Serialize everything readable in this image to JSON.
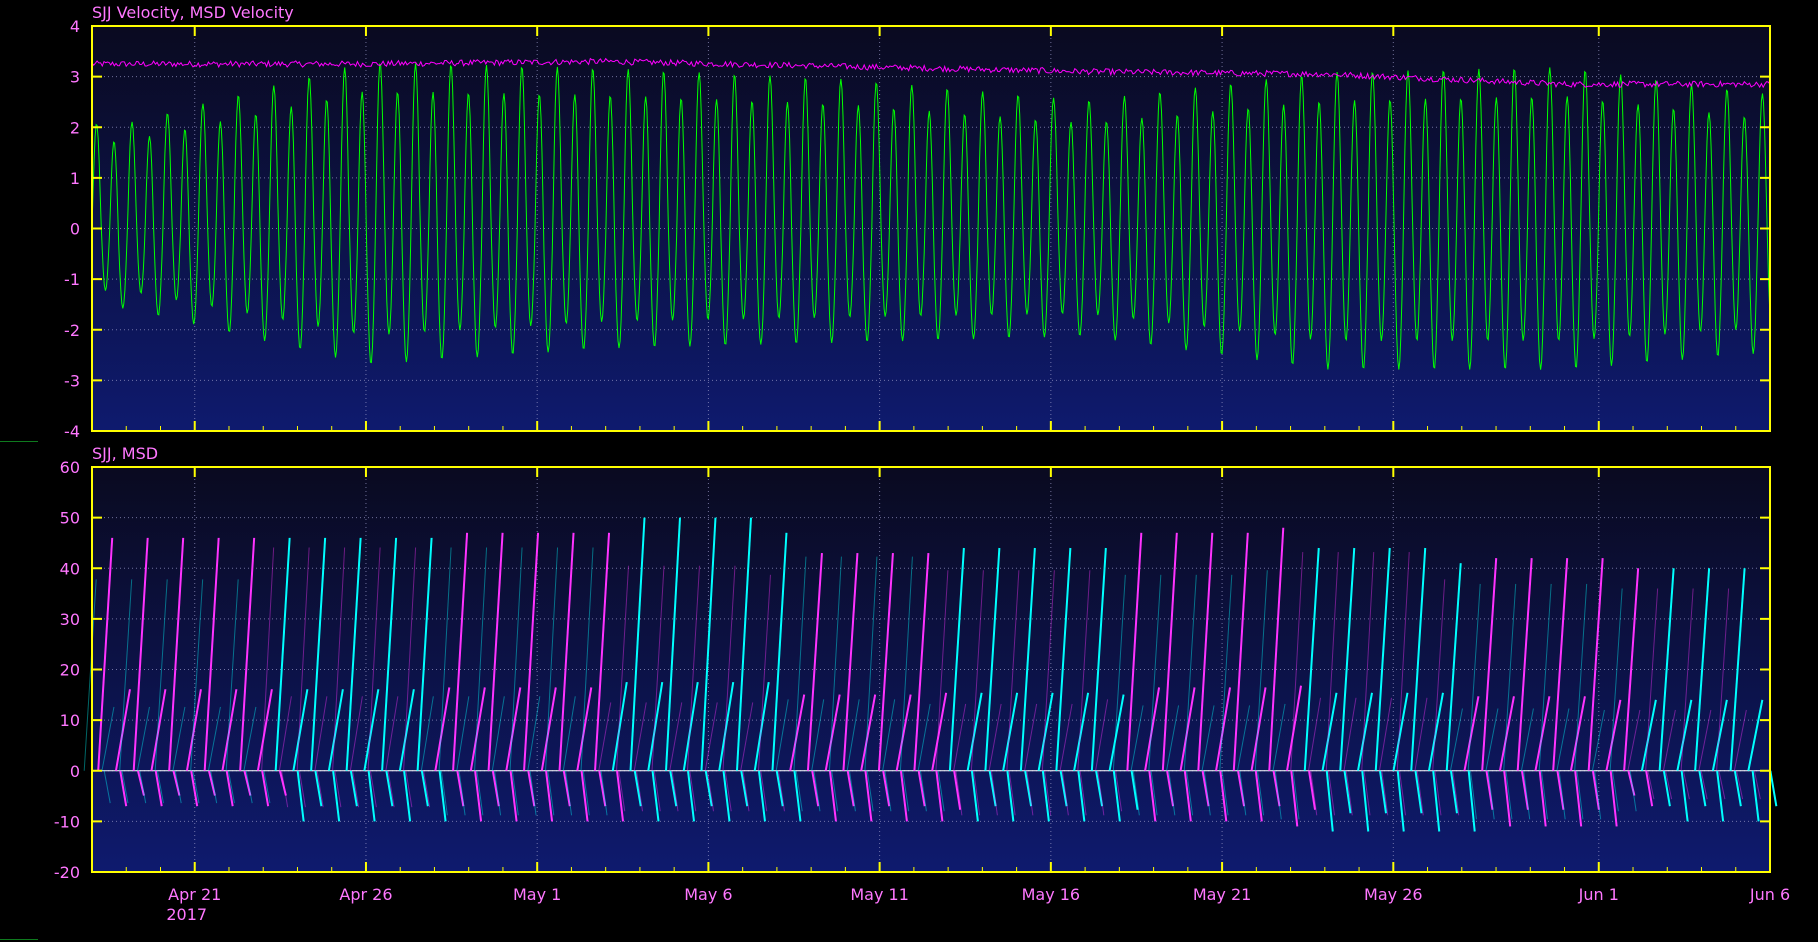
{
  "colors": {
    "background": "#000000",
    "frame": "#ffff00",
    "grid": "#9a9ac8",
    "label": "#ff77ff",
    "panel_top": "#0a0a20",
    "panel_bottom": "#0e1a6e",
    "sjj_velocity": "#00ff00",
    "msd_velocity": "#ff00ff",
    "sjj": "#ff33ff",
    "msd": "#00ffff",
    "side_mark": "#0e7a1e"
  },
  "chart_data": [
    {
      "type": "line",
      "title": "SJJ Velocity, MSD Velocity",
      "xlabel": "",
      "ylabel": "",
      "ylim": [
        -4,
        4
      ],
      "yticks": [
        "4",
        "3",
        "2",
        "1",
        "0",
        "-1",
        "-2",
        "-3",
        "-4"
      ],
      "grid": true,
      "series": [
        {
          "name": "MSD Velocity",
          "color": "#ff00ff",
          "description_of_shape": "noisy near-constant signal",
          "x_dates": [
            "2017-04-19",
            "2017-04-26",
            "2017-05-03",
            "2017-05-10",
            "2017-05-17",
            "2017-05-24",
            "2017-05-31",
            "2017-06-06"
          ],
          "values": [
            3.25,
            3.25,
            3.3,
            3.2,
            3.1,
            3.05,
            2.85,
            2.85
          ]
        },
        {
          "name": "SJJ Velocity",
          "color": "#00ff00",
          "description_of_shape": "tidal oscillation, two cycles per day",
          "x_dates": [
            "2017-04-19",
            "2017-04-26",
            "2017-05-03",
            "2017-05-10",
            "2017-05-17",
            "2017-05-24",
            "2017-05-31",
            "2017-06-06"
          ],
          "high_values": [
            1.9,
            3.0,
            2.9,
            2.7,
            2.3,
            2.8,
            2.9,
            2.4
          ],
          "low_values": [
            -1.4,
            -2.4,
            -2.1,
            -2.0,
            -1.9,
            -2.5,
            -2.5,
            -2.2
          ]
        }
      ]
    },
    {
      "type": "line",
      "title": "SJJ, MSD",
      "xlabel": "",
      "ylabel": "",
      "ylim": [
        -20,
        60
      ],
      "yticks": [
        "60",
        "50",
        "40",
        "30",
        "20",
        "10",
        "0",
        "-10",
        "-20"
      ],
      "grid": true,
      "series": [
        {
          "name": "SJJ",
          "color": "#ff33ff",
          "description_of_shape": "repeating sawtooth ramps",
          "peak_values": [
            46,
            49,
            47,
            45,
            43,
            44,
            47,
            48,
            42,
            40
          ],
          "trough_values": [
            -7,
            -9,
            -10,
            -10,
            -10,
            -11,
            -10,
            -11,
            -11,
            -7
          ]
        },
        {
          "name": "MSD",
          "color": "#00ffff",
          "description_of_shape": "repeating sawtooth ramps",
          "peak_values": [
            42,
            46,
            49,
            50,
            47,
            44,
            43,
            44,
            41,
            40
          ],
          "trough_values": [
            -8,
            -10,
            -11,
            -10,
            -10,
            -10,
            -11,
            -12,
            -12,
            -10
          ]
        }
      ]
    }
  ],
  "x_axis": {
    "date_range": [
      "2017-04-18",
      "2017-06-06"
    ],
    "ticks": [
      {
        "date": "2017-04-21",
        "label": "Apr 21",
        "sublabel": "2017"
      },
      {
        "date": "2017-04-26",
        "label": "Apr 26",
        "sublabel": ""
      },
      {
        "date": "2017-05-01",
        "label": "May 1",
        "sublabel": ""
      },
      {
        "date": "2017-05-06",
        "label": "May 6",
        "sublabel": ""
      },
      {
        "date": "2017-05-11",
        "label": "May 11",
        "sublabel": ""
      },
      {
        "date": "2017-05-16",
        "label": "May 16",
        "sublabel": ""
      },
      {
        "date": "2017-05-21",
        "label": "May 21",
        "sublabel": ""
      },
      {
        "date": "2017-05-26",
        "label": "May 26",
        "sublabel": ""
      },
      {
        "date": "2017-06-01",
        "label": "Jun 1",
        "sublabel": ""
      },
      {
        "date": "2017-06-06",
        "label": "Jun 6",
        "sublabel": ""
      }
    ]
  }
}
